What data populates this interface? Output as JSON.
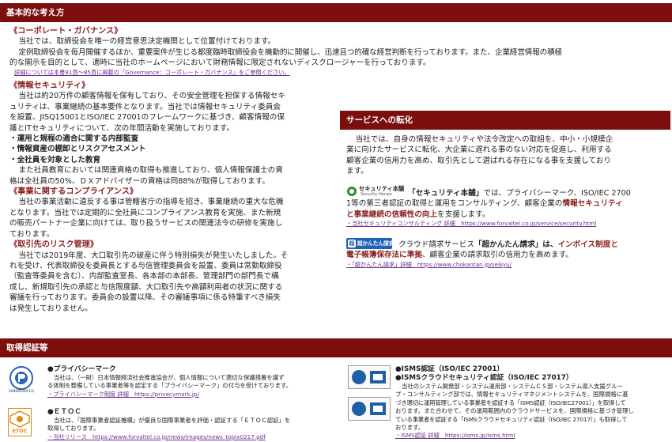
{
  "sections": {
    "basic": {
      "title": "基本的な考え方",
      "governance": {
        "heading": "《コーポレート・ガバナンス》",
        "lines": [
          "当社では、取締役会を唯一の経営意思決定機関として位置付けております。",
          "定例取締役会を毎月開催するほか、重要案件が生じる都度臨時取締役会を機動的に開催し、迅速且つ的確な経営判断を行っております。また、企業経営情報の積極",
          "的な開示を目的として、適時に当社のホームページにおいて財務情報に限定されないディスクロージャーを行っております。"
        ],
        "link": "詳細については本書81頁～85頁に掲載の「Governance：コーポレート・ガバナンス」をご参照ください。"
      },
      "security": {
        "heading": "《情報セキュリティ》",
        "lines": [
          "当社は約20万件の顧客情報を保有しており、その安全管理を担保する情報セキ",
          "ュリティは、事業継続の基本要件となります。当社では情報セキュリティ委員会",
          "を設置、JISQ15001とISO/IEC 27001のフレームワークに基づき、顧客情報の保",
          "護とITセキュリティについて、次の年間活動を実施しております。"
        ],
        "bullets": [
          "・運用と規程の適合に関する内部監査",
          "・情報資産の棚卸とリスクアセスメント",
          "・全社員を対象とした教育"
        ],
        "lines2": [
          "また社員教育においては関連資格の取得も推進しており、個人情報保護士の資",
          "格は全社員の50%、ＤＸアドバイザーの資格は同88%が取得しております。"
        ]
      },
      "compliance": {
        "heading": "《事業に関するコンプライアンス》",
        "lines": [
          "当社の事業活動に違反する事は管轄省庁の指導を招き、事業継続の重大な危機",
          "となります。当社では定期的に全社員にコンプライアンス教育を実施、また新規",
          "の販売パートナー企業に向けては、取り扱うサービスの関連法令の研修を実施し",
          "ております。"
        ]
      },
      "partner": {
        "heading": "《取引先のリスク管理》",
        "lines": [
          "当社では2019年度、大口取引先の破産に伴う特別損失が発生いたしました。そ",
          "れを受け、代表取締役を委員長とする与信管理委員会を設置、委員は常勤取締役",
          "（監査等委員を含む）、内部監査室長、各本部の本部長、管理部門の部門長で構",
          "成し、新規取引先の承認と与信限度額、大口取引先や高額利用者の状況に関する",
          "審議を行っております。委員会の設置以降、その審議事項に係る特筆すべき損失",
          "は発生しておりません。"
        ]
      }
    },
    "service": {
      "title": "サービスへの転化",
      "lines": [
        "当社では、自身の情報セキュリティや法令改定への取組を、中小・小規模企",
        "業に向けたサービスに転化、大企業に遅れる事のない対応を促進し、利用する",
        "顧客企業の信用力を高め、取引先として選ばれる存在になる事を支援しており",
        "ます。"
      ],
      "security_honsha": {
        "logo_text": "セキュリティ本舗",
        "logo_sub": "Security Honpo",
        "line1_a": "「セキュリティ本舗」",
        "line1_b": "では、プライバシーマーク、ISO/IEC 2700",
        "line2_a": "1等の第三者認証の取得と運用をコンサルティング、顧客企業の",
        "line2_b": "情報セキュリティ",
        "line3_a": "と事業継続の信頼性の向上",
        "line3_b": "を支援します。",
        "link": "・当社セキュリティコンサルティング 詳細　https://www.forvaltel.co.jp/service/security.html"
      },
      "chokantan": {
        "logo_text": "超かんたん請求",
        "line1_a": "クラウド請求サービス",
        "line1_b": "「超かんたん請求」",
        "line1_c": "は、",
        "line1_d": "インボイス制度と",
        "line2_a": "電子帳簿保存法に準拠",
        "line2_b": "、顧客企業の請求取引の信用力を高めます。",
        "link": "・「超かんたん請求」詳細　https://www.chokantan.jp/seikyu/"
      }
    },
    "certifications": {
      "title": "取得認証等",
      "pmark": {
        "title": "●プライバシーマーク",
        "lines": [
          "当社は、（一財）日本情報経済社会推進協会が、個人情報について適切な保護措置を講ず",
          "る体制を整備している事業者等を認定する「プライバシーマーク」の付与を受けております。"
        ],
        "link": "・プライバシーマーク制度 詳細　https://privacymark.jp/",
        "logo_text": "プライバシーマーク",
        "logo_num": "10800049(11)"
      },
      "etoc": {
        "title": "●ＥＴＯＣ",
        "lines": [
          "当社は、「国際事業者認証機構」が優良な国際事業者を評価・認証する「ＥＴＯＣ認証」を",
          "取得しております。"
        ],
        "link": "・当社リリース　https://www.forvaltel.co.jp/news/images/news_topix0217.pdf",
        "logo_text": "ETOC"
      },
      "isms": {
        "title1": "●ISMS認証（ISO/IEC 27001）",
        "title2": "●ISMSクラウドセキュリティ認証（ISO/IEC 27017）",
        "lines": [
          "当社のシステム開発部・システム運用部・システムＣＳ部・システム導入支援グルー",
          "プ・コンサルティング部では、情報セキュリティマネジメントシステムを、国際規格に基",
          "づき適切に運用管理している事業者を認証する「ISMS認証（ISO/IEC27001）」を取得して",
          "おります。また合わせて、その運用範囲内のクラウドサービスを、国際規格に基づき管理し",
          "ている事業者を認証する「ISMSクラウドセキュリティ認証（ISO/IEC 27017）」も取得して",
          "おります。"
        ],
        "link": "・ISMS認証 詳細　https://isms.jp/isms.html",
        "logo1_text": "ISMS-AC",
        "logo2_text": "ISMS-AC"
      }
    }
  },
  "colors": {
    "brand": "#7d0e0e",
    "heading": "#8a1f1f",
    "link": "#6b2f8a",
    "pmark": "#2a63b8",
    "etoc": "#e08a1a"
  }
}
